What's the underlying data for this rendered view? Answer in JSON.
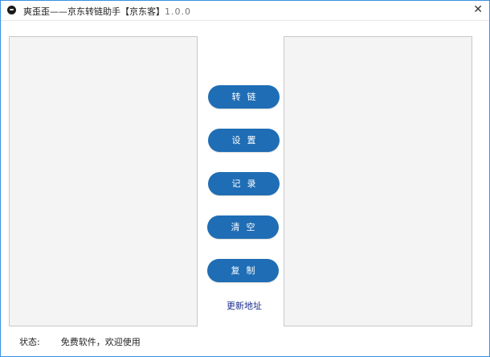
{
  "window": {
    "title": "爽歪歪——京东转链助手【京东客】",
    "version": "1.0.0",
    "close_glyph": "✕"
  },
  "buttons": {
    "convert": "转链",
    "settings": "设置",
    "records": "记录",
    "clear": "清空",
    "copy": "复制"
  },
  "update_link": "更新地址",
  "status": {
    "label": "状态:",
    "value": "免费软件，欢迎使用"
  },
  "colors": {
    "button": "#1f6db5",
    "link": "#1a2c8e",
    "border": "#3c8fe0"
  }
}
